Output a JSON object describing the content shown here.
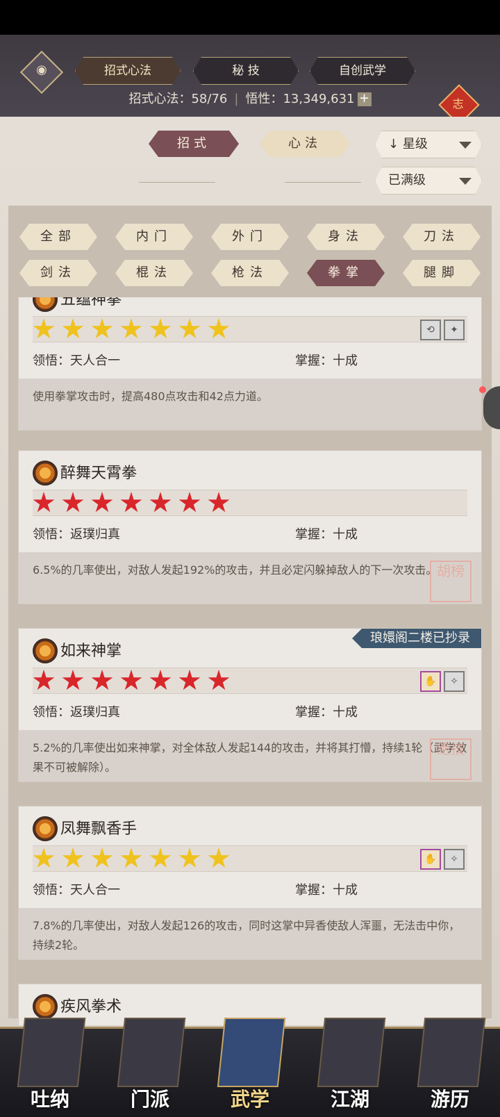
{
  "header": {
    "tabs": [
      "招式心法",
      "秘 技",
      "自创武学"
    ],
    "active_tab": 0,
    "stats_label1": "招式心法：",
    "stats_value1": "58/76",
    "stats_label2": "悟性：",
    "stats_value2": "13,349,631",
    "plus": "+",
    "knot": "志"
  },
  "toggle": {
    "left": "招式",
    "right": "心法"
  },
  "sort": {
    "star": "星级",
    "level": "已满级",
    "arrow": "↓"
  },
  "filters": [
    "全部",
    "内门",
    "外门",
    "身法",
    "刀法",
    "剑法",
    "棍法",
    "枪法",
    "拳掌",
    "腿脚"
  ],
  "active_filter": 8,
  "cards": [
    {
      "name": "五蕴神拳",
      "stars": 7,
      "star_color": "gold",
      "insight_label": "领悟：",
      "insight": "天人合一",
      "mastery_label": "掌握：",
      "mastery": "十成",
      "desc": "使用拳掌攻击时，提高480点攻击和42点力道。"
    },
    {
      "name": "醉舞天霄拳",
      "stars": 7,
      "star_color": "red",
      "insight_label": "领悟：",
      "insight": "返璞归真",
      "mastery_label": "掌握：",
      "mastery": "十成",
      "desc": "6.5%的几率使出，对敌人发起192%的攻击，并且必定闪躲掉敌人的下一次攻击。",
      "stamp": "胡榜"
    },
    {
      "name": "如来神掌",
      "stars": 7,
      "star_color": "red",
      "insight_label": "领悟：",
      "insight": "返璞归真",
      "mastery_label": "掌握：",
      "mastery": "十成",
      "desc": "5.2%的几率使出如来神掌，对全体敌人发起144的攻击，并将其打懵，持续1轮（武学效果不可被解除）。",
      "ribbon": "琅嬛阁二楼已抄录",
      "stamp": "绝技"
    },
    {
      "name": "凤舞飘香手",
      "stars": 7,
      "star_color": "gold",
      "insight_label": "领悟：",
      "insight": "天人合一",
      "mastery_label": "掌握：",
      "mastery": "十成",
      "desc": "7.8%的几率使出，对敌人发起126的攻击，同时这掌中异香使敌人浑噩，无法击中你，持续2轮。"
    },
    {
      "name": "疾风拳术"
    }
  ],
  "nav": [
    "吐纳",
    "门派",
    "武学",
    "江湖",
    "游历"
  ],
  "active_nav": 2
}
